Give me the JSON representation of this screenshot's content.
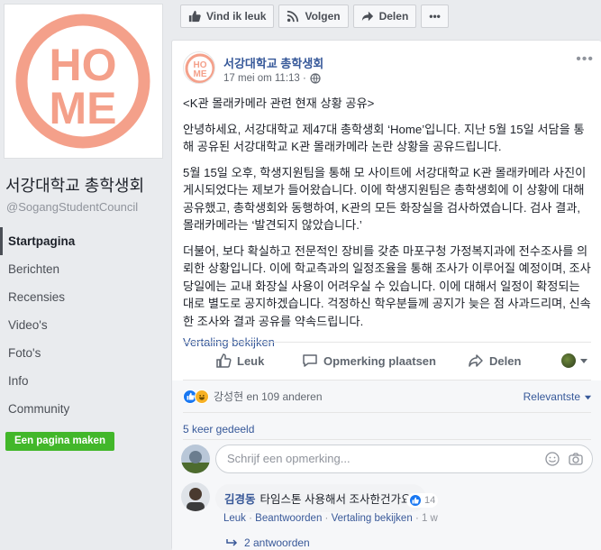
{
  "page": {
    "name": "서강대학교 총학생회",
    "handle": "@SogangStudentCouncil",
    "logo_text": "HOME",
    "brand_color": "#f4a08a"
  },
  "sidebar": {
    "items": [
      {
        "label": "Startpagina"
      },
      {
        "label": "Berichten"
      },
      {
        "label": "Recensies"
      },
      {
        "label": "Video's"
      },
      {
        "label": "Foto's"
      },
      {
        "label": "Info"
      },
      {
        "label": "Community"
      }
    ],
    "create_label": "Een pagina maken"
  },
  "topbar": {
    "like_label": "Vind ik leuk",
    "follow_label": "Volgen",
    "share_label": "Delen",
    "more_label": "•••"
  },
  "post": {
    "author": "서강대학교 총학생회",
    "date": "17 mei om 11:13 ·",
    "menu": "•••",
    "paragraphs": [
      "<K관 몰래카메라 관련 현재 상황 공유>",
      "안녕하세요, 서강대학교 제47대 총학생회 ‘Home’입니다. 지난 5월 15일 서담을 통해 공유된 서강대학교 K관 몰래카메라 논란 상황을 공유드립니다.",
      "5월 15일 오후, 학생지원팀을 통해 모 사이트에 서강대학교 K관 몰래카메라 사진이 게시되었다는 제보가 들어왔습니다. 이에 학생지원팀은 총학생회에 이 상황에 대해 공유했고, 총학생회와 동행하여, K관의 모든 화장실을 검사하였습니다. 검사 결과, 몰래카메라는 ‘발견되지 않았습니다.’",
      "더불어, 보다 확실하고 전문적인 장비를 갖춘 마포구청 가정복지과에 전수조사를 의뢰한 상황입니다. 이에 학교측과의 일정조율을 통해 조사가 이루어질 예정이며, 조사 당일에는 교내 화장실 사용이 어려우실 수 있습니다. 이에 대해서 일정이 확정되는 대로 별도로 공지하겠습니다. 걱정하신 학우분들께 공지가 늦은 점 사과드리며, 신속한 조사와 결과 공유를 약속드립니다."
    ],
    "translate_label": "Vertaling bekijken"
  },
  "actions": {
    "like": "Leuk",
    "comment": "Opmerking plaatsen",
    "share": "Delen"
  },
  "engagement": {
    "reactions_text": "강성현 en 109 anderen",
    "sort_label": "Relevantste",
    "shares_text": "5 keer gedeeld"
  },
  "comment_box": {
    "placeholder": "Schrijf een opmerking..."
  },
  "reply": {
    "name": "김경동",
    "text": "타임스톤 사용해서 조사한건가요?",
    "likes": "14",
    "like_action": "Leuk",
    "reply_action": "Beantwoorden",
    "translate_action": "Vertaling bekijken",
    "time": "1 w",
    "more_replies": "2 antwoorden"
  }
}
